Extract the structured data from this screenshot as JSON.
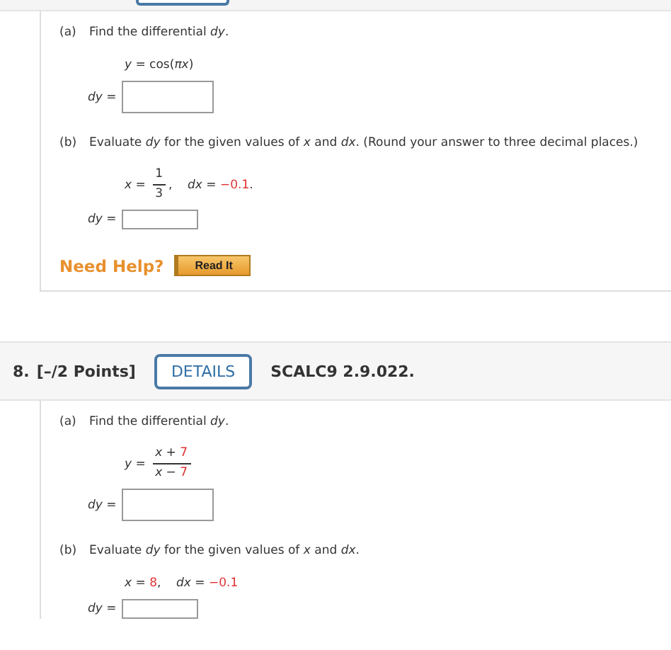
{
  "question_7": {
    "parts": [
      {
        "label": "(a)",
        "prompt": "Find the differential *dy*.",
        "equation": [
          {
            "kind": "text",
            "text": "*y* = cos("
          },
          {
            "kind": "var",
            "text": "πx"
          },
          {
            "kind": "text",
            "text": ")"
          }
        ],
        "answer_label": "*dy* =",
        "answer_field": {
          "kind": "large"
        }
      },
      {
        "label": "(b)",
        "prompt": "Evaluate *dy* for the given values of *x* and *dx*. (Round your answer to three decimal places.)",
        "equation": [
          {
            "kind": "text",
            "text": "*x* = "
          },
          {
            "kind": "fraction",
            "numerator": [
              {
                "kind": "text",
                "text": "1"
              }
            ],
            "denominator": [
              {
                "kind": "text",
                "text": "3"
              }
            ]
          },
          {
            "kind": "text",
            "text": ",    *dx* = "
          },
          {
            "kind": "given",
            "text": "−0.1"
          },
          {
            "kind": "text",
            "text": "."
          }
        ],
        "answer_label": "*dy* =",
        "answer_field": {
          "kind": "small"
        }
      }
    ],
    "help": {
      "label": "Need Help?",
      "button": "Read It"
    }
  },
  "question_8": {
    "number": "8.",
    "points": "[–/2 Points]",
    "details_button": "DETAILS",
    "source": "SCALC9 2.9.022.",
    "parts": [
      {
        "label": "(a)",
        "prompt": "Find the differential *dy*.",
        "equation": [
          {
            "kind": "text",
            "text": "*y* = "
          },
          {
            "kind": "fraction",
            "numerator": [
              {
                "kind": "text",
                "text": "*x* + "
              },
              {
                "kind": "given",
                "text": "7"
              }
            ],
            "denominator": [
              {
                "kind": "text",
                "text": "*x* − "
              },
              {
                "kind": "given",
                "text": "7"
              }
            ]
          }
        ],
        "answer_label": "*dy* =",
        "answer_field": {
          "kind": "large"
        }
      },
      {
        "label": "(b)",
        "prompt": "Evaluate *dy* for the given values of *x* and *dx*.",
        "equation": [
          {
            "kind": "text",
            "text": "*x* = "
          },
          {
            "kind": "given",
            "text": "8"
          },
          {
            "kind": "text",
            "text": ",    *dx* = "
          },
          {
            "kind": "given",
            "text": "−0.1"
          }
        ],
        "answer_label": "*dy* =",
        "answer_field": {
          "kind": "small"
        }
      }
    ]
  }
}
